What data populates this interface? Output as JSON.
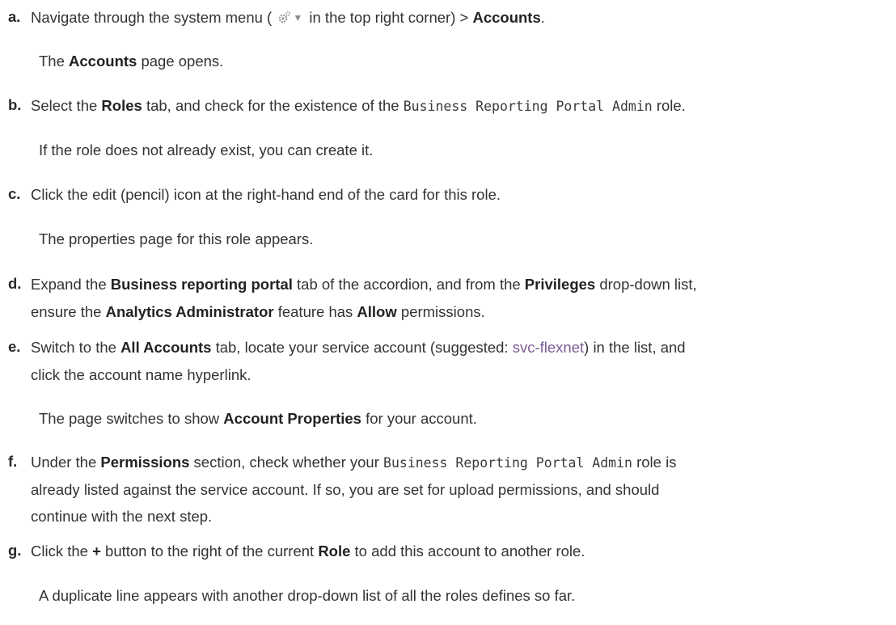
{
  "steps": [
    {
      "id": "a",
      "letter": "a.",
      "line1": {
        "t1": "Navigate through the system menu (",
        "t2": " in the top right corner) > ",
        "b1": "Accounts",
        "t3": "."
      },
      "note": {
        "b1": "The ",
        "bold": "Accounts",
        "t2": " page opens."
      }
    },
    {
      "id": "b",
      "letter": "b.",
      "line1": {
        "t1": "Select the ",
        "b1": "Roles",
        "t2": " tab, and check for the existence of the ",
        "code": "Business Reporting Portal Admin",
        "t3": " role."
      },
      "note": "If the role does not already exist, you can create it."
    },
    {
      "id": "c",
      "letter": "c.",
      "line1": "Click the edit (pencil) icon at the right-hand end of the card for this role.",
      "note": "The properties page for this role appears."
    },
    {
      "id": "d",
      "letter": "d.",
      "line1": {
        "t1": "Expand the ",
        "b1": "Business reporting portal",
        "t2": " tab of the accordion, and from the ",
        "b2": "Privileges",
        "t3": " drop-down list,"
      },
      "line2": {
        "t1": "ensure the ",
        "b1": "Analytics Administrator",
        "t2": " feature has ",
        "b2": "Allow",
        "t3": " permissions."
      }
    },
    {
      "id": "e",
      "letter": "e.",
      "line1": {
        "t1": "Switch to the ",
        "b1": "All Accounts",
        "t2": " tab, locate your service account (suggested: ",
        "link": "svc-flexnet",
        "t3": ") in the list, and"
      },
      "line2": "click the account name hyperlink.",
      "note": {
        "t1": "The page switches to show ",
        "b1": "Account Properties",
        "t2": " for your account."
      }
    },
    {
      "id": "f",
      "letter": "f.",
      "line1": {
        "t1": "Under the ",
        "b1": "Permissions",
        "t2": " section, check whether your ",
        "code": "Business Reporting Portal Admin",
        "t3": " role is"
      },
      "line2": "already listed against the service account. If so, you are set for upload permissions, and should",
      "line3": "continue with the next step."
    },
    {
      "id": "g",
      "letter": "g.",
      "line1": {
        "t1": "Click the ",
        "b1": "+",
        "t2": " button to the right of the current ",
        "b2": "Role",
        "t3": " to add this account to another role."
      },
      "note": "A duplicate line appears with another drop-down list of all the roles defines so far."
    }
  ],
  "icons": {
    "menu_gear": "gear-icon",
    "menu_dropdown": "dropdown-triangle-icon"
  }
}
